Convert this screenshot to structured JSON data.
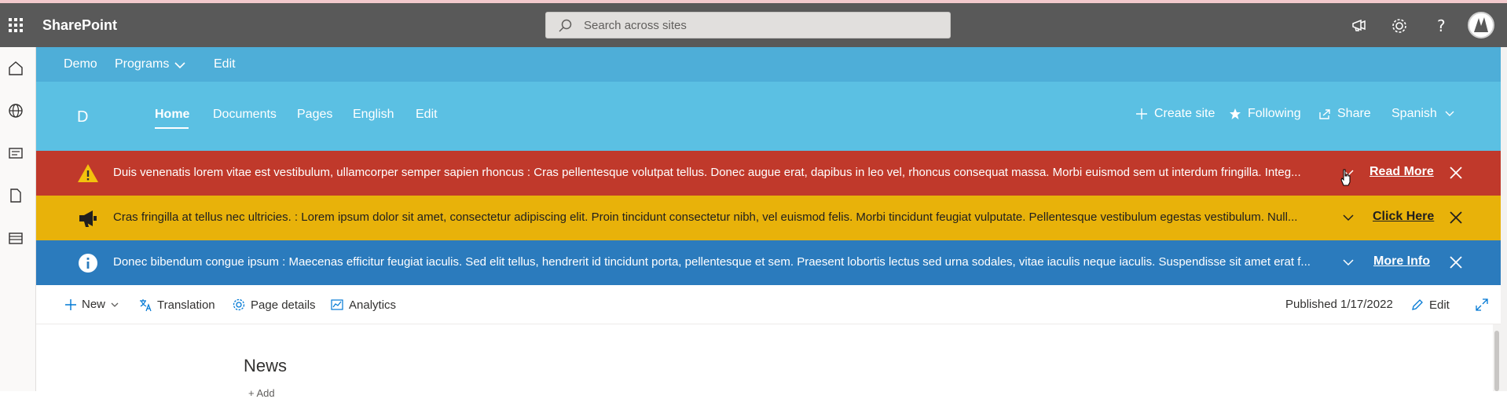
{
  "topbar": {
    "brand": "SharePoint",
    "search_placeholder": "Search across sites",
    "icons": [
      "waffle-icon",
      "search-icon",
      "megaphone-icon",
      "gear-icon",
      "help-icon",
      "avatar"
    ]
  },
  "left_rail": {
    "icons": [
      "home-icon",
      "globe-icon",
      "news-icon",
      "file-icon",
      "list-icon"
    ]
  },
  "hub_nav": {
    "items": [
      "Demo",
      "Programs",
      "Edit"
    ]
  },
  "site_header": {
    "logo_letter": "D",
    "nav": [
      "Home",
      "Documents",
      "Pages",
      "English",
      "Edit"
    ],
    "actions": {
      "create_site": "Create site",
      "following": "Following",
      "share": "Share",
      "language": "Spanish"
    }
  },
  "banners": [
    {
      "text": "Duis venenatis lorem vitae est vestibulum, ullamcorper semper sapien rhoncus : Cras pellentesque volutpat tellus. Donec augue erat, dapibus in leo vel, rhoncus consequat massa. Morbi euismod sem ut interdum fringilla. Integ...",
      "link": "Read More",
      "color": "#c0392b",
      "icon": "warning-icon"
    },
    {
      "text": "Cras fringilla at tellus nec ultricies. : Lorem ipsum dolor sit amet, consectetur adipiscing elit. Proin tincidunt consectetur nibh, vel euismod felis. Morbi tincidunt feugiat vulputate. Pellentesque vestibulum egestas vestibulum. Null...",
      "link": "Click Here",
      "color": "#e8b20a",
      "icon": "megaphone-icon"
    },
    {
      "text": "Donec bibendum congue ipsum : Maecenas efficitur feugiat iaculis. Sed elit tellus, hendrerit id tincidunt porta, pellentesque et sem. Praesent lobortis lectus sed urna sodales, vitae iaculis neque iaculis. Suspendisse sit amet erat f...",
      "link": "More Info",
      "color": "#2b7bbd",
      "icon": "info-icon"
    }
  ],
  "command_bar": {
    "new": "New",
    "translation": "Translation",
    "page_details": "Page details",
    "analytics": "Analytics",
    "published": "Published 1/17/2022",
    "edit": "Edit"
  },
  "content": {
    "news_title": "News",
    "add_link": "+ Add"
  },
  "colors": {
    "topbar": "#595959",
    "hubnav": "#4eaed8",
    "siteheader": "#5bc0e3",
    "red_banner": "#c0392b",
    "yellow_banner": "#e8b20a",
    "blue_banner": "#2b7bbd"
  }
}
